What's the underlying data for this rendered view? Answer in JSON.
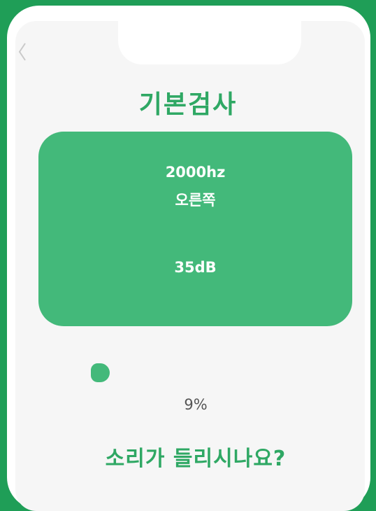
{
  "screen": {
    "title": "기본검사",
    "frequency": "2000hz",
    "ear_side": "오른쪽",
    "level": "35dB",
    "progress_percent": 9,
    "progress_label": "9%",
    "question": "소리가 들리시나요?"
  },
  "colors": {
    "accent": "#43b97a",
    "title_green": "#2fa864",
    "background": "#1f9e57"
  },
  "icons": {
    "back": "chevron-left-icon"
  }
}
